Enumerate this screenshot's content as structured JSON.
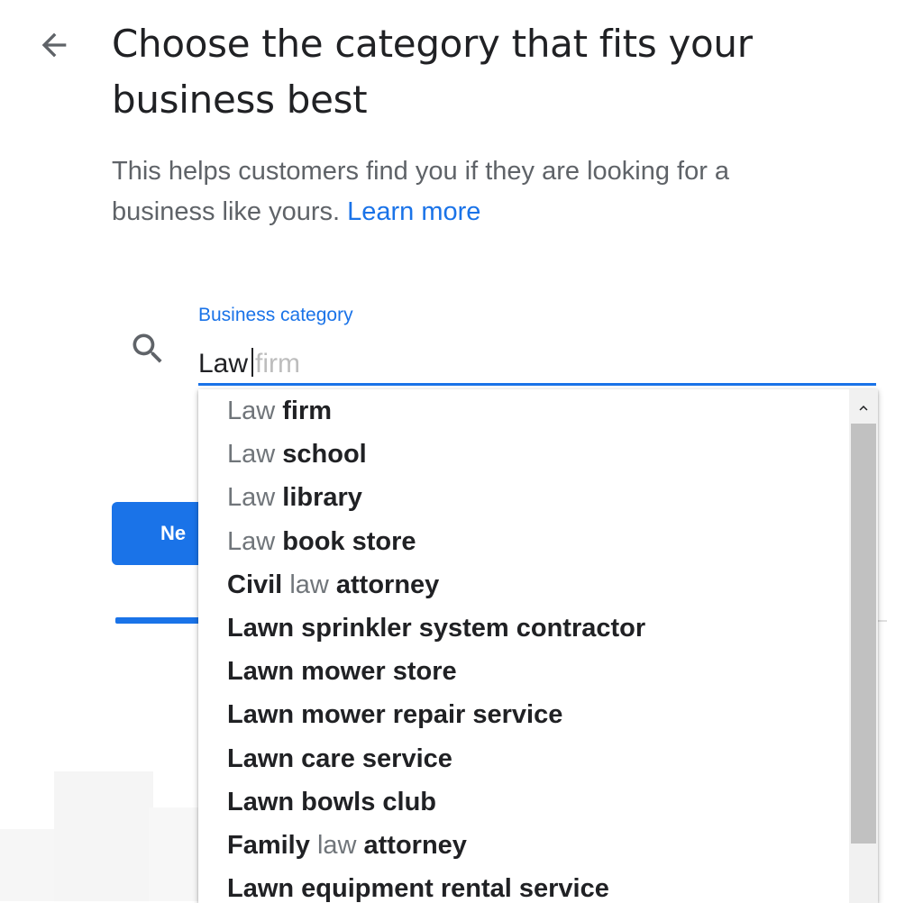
{
  "header": {
    "back_icon": "arrow-back-icon",
    "title": "Choose the category that fits your business best"
  },
  "subtitle": {
    "text": "This helps customers find you if they are looking for a business like yours.",
    "link": "Learn more"
  },
  "field": {
    "search_icon": "search-icon",
    "label": "Business category",
    "value": "Law",
    "suggestion_completion": "firm"
  },
  "next_button": {
    "label": "Next",
    "visible_label": "Ne"
  },
  "progress": {
    "fraction": 0.11
  },
  "dropdown": {
    "scroll_up_icon": "chevron-up-icon",
    "options": [
      {
        "pre": "",
        "match": "Law",
        "post": " firm"
      },
      {
        "pre": "",
        "match": "Law",
        "post": " school"
      },
      {
        "pre": "",
        "match": "Law",
        "post": " library"
      },
      {
        "pre": "",
        "match": "Law",
        "post": " book store"
      },
      {
        "pre": "Civil ",
        "match": "law",
        "post": " attorney"
      },
      {
        "pre": "Lawn sprinkler system contractor",
        "match": "",
        "post": ""
      },
      {
        "pre": "Lawn mower store",
        "match": "",
        "post": ""
      },
      {
        "pre": "Lawn mower repair service",
        "match": "",
        "post": ""
      },
      {
        "pre": "Lawn care service",
        "match": "",
        "post": ""
      },
      {
        "pre": "Lawn bowls club",
        "match": "",
        "post": ""
      },
      {
        "pre": "Family ",
        "match": "law",
        "post": " attorney"
      },
      {
        "pre": "Lawn equipment rental service",
        "match": "",
        "post": ""
      }
    ]
  },
  "colors": {
    "accent": "#1a73e8",
    "text": "#202124",
    "secondary_text": "#5f6368",
    "match_text": "#70757a"
  }
}
